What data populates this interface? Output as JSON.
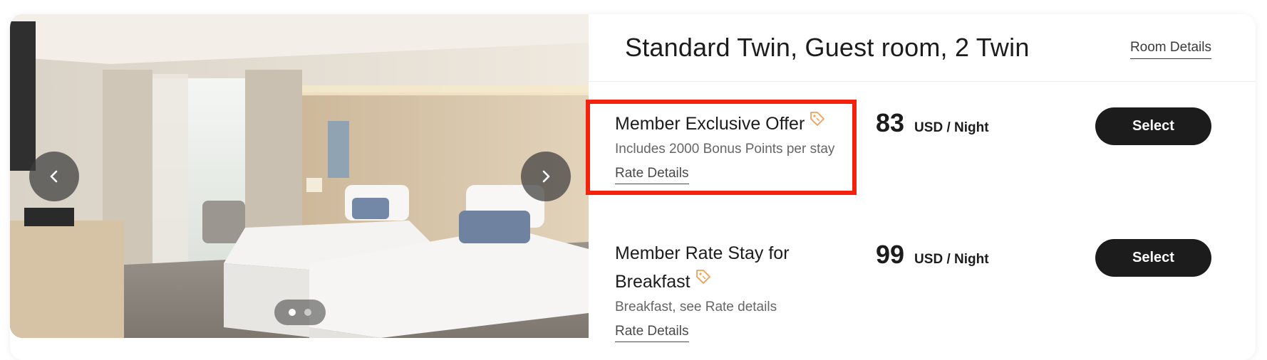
{
  "room": {
    "title": "Standard Twin, Guest room, 2 Twin",
    "details_link": "Room Details"
  },
  "gallery": {
    "prev_icon": "chevron-left-icon",
    "next_icon": "chevron-right-icon",
    "slide_count": 2,
    "active_slide": 1
  },
  "rates": [
    {
      "name": "Member Exclusive Offer",
      "name_line1": "Member Exclusive Offer",
      "name_line2": "",
      "icon": "tag-icon",
      "description": "Includes 2000 Bonus Points per stay",
      "details_link": "Rate Details",
      "price": "83",
      "unit": "USD / Night",
      "select_label": "Select",
      "highlighted": true
    },
    {
      "name": "Member Rate Stay for Breakfast",
      "name_line1": "Member Rate Stay for",
      "name_line2": "Breakfast",
      "icon": "tag-icon",
      "description": "Breakfast, see Rate details",
      "details_link": "Rate Details",
      "price": "99",
      "unit": "USD / Night",
      "select_label": "Select",
      "highlighted": false
    }
  ],
  "colors": {
    "highlight": "#f4210d",
    "tag_icon": "#f0a05a",
    "button": "#1c1c1c"
  }
}
